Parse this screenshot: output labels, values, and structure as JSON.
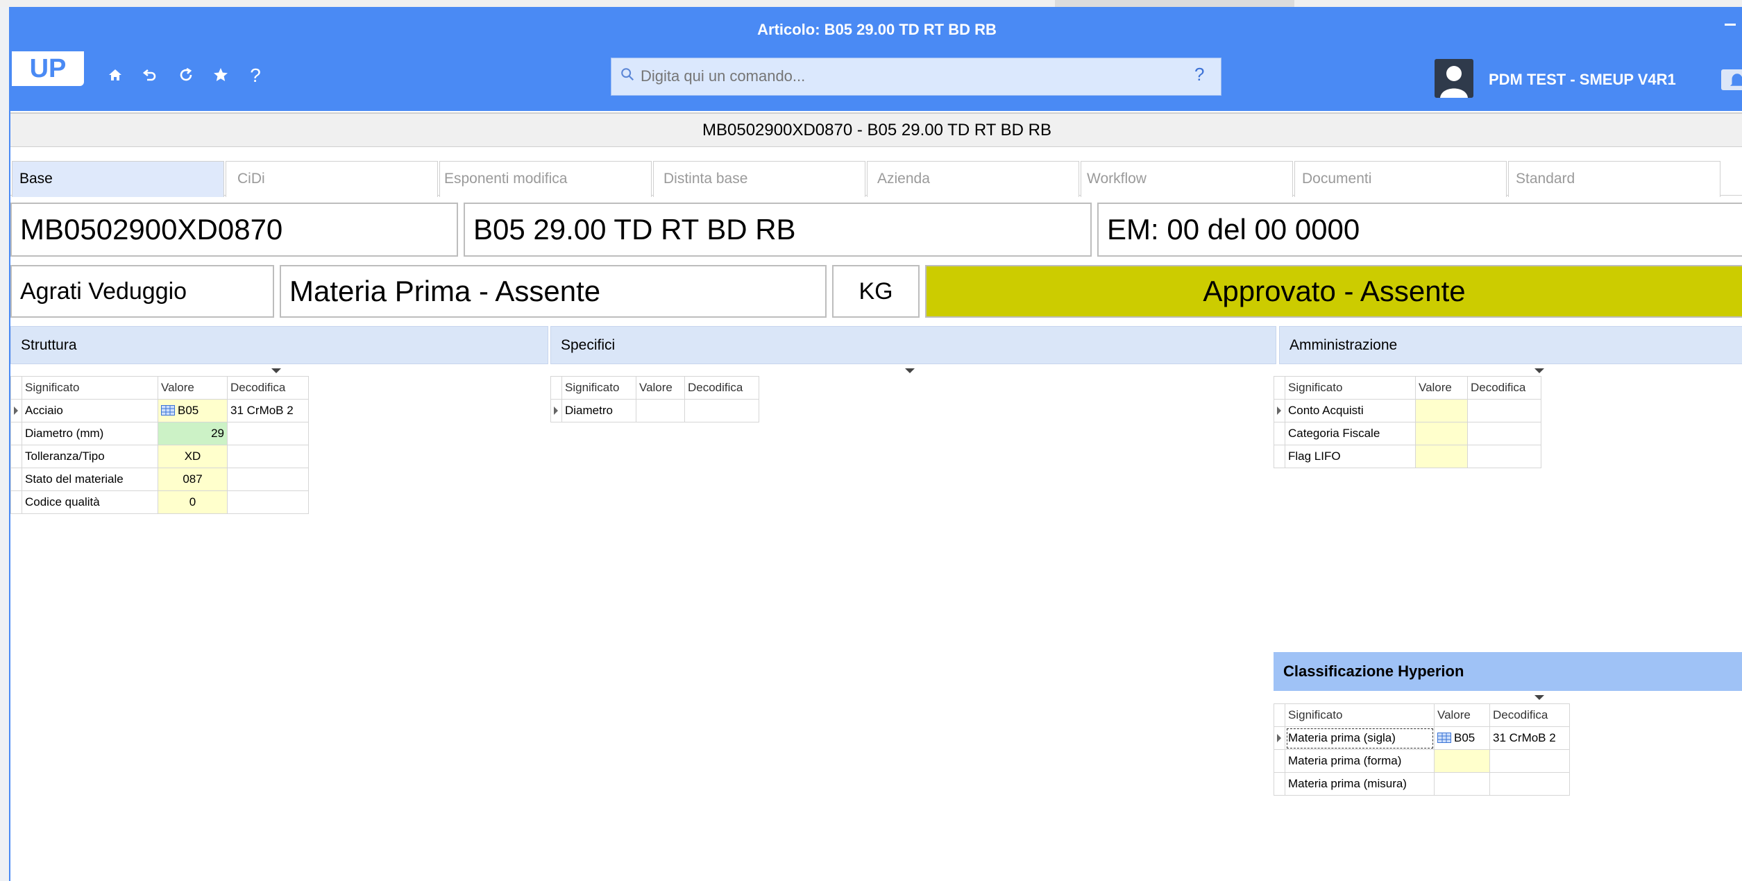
{
  "window": {
    "title": "Articolo: B05 29.00 TD RT BD RB"
  },
  "toolbar": {
    "logo": "UP",
    "home_icon": "home-icon",
    "back_icon": "undo-icon",
    "refresh_icon": "refresh-icon",
    "favorite_icon": "star-icon",
    "help_label": "?"
  },
  "search": {
    "placeholder": "Digita qui un comando...",
    "help": "?"
  },
  "user": {
    "name": "PDM TEST - SMEUP V4R1"
  },
  "item_bar": "MB0502900XD0870 - B05 29.00 TD RT BD RB",
  "tabs": [
    {
      "label": "Base"
    },
    {
      "label": "CiDi"
    },
    {
      "label": "Esponenti modifica"
    },
    {
      "label": "Distinta base"
    },
    {
      "label": "Azienda"
    },
    {
      "label": "Workflow"
    },
    {
      "label": "Documenti"
    },
    {
      "label": "Standard"
    }
  ],
  "header_fields": {
    "code": "MB0502900XD0870",
    "description": "B05 29.00 TD RT BD RB",
    "em": "EM: 00 del 00  0000",
    "plant": "Agrati Veduggio",
    "type": "Materia Prima - Assente",
    "unit": "KG",
    "status": "Approvato - Assente"
  },
  "colors": {
    "accent": "#4a8af4",
    "status": "#cccc00",
    "section": "#dae6f8",
    "value_cell": "#ffffcc",
    "value_numeric": "#ccf2c6"
  },
  "columns": {
    "significato": "Significato",
    "valore": "Valore",
    "decodifica": "Decodifica"
  },
  "struttura": {
    "title": "Struttura",
    "rows": [
      {
        "significato": "Acciaio",
        "valore": "B05",
        "decodifica": "31 CrMoB 2"
      },
      {
        "significato": "Diametro (mm)",
        "valore": "29",
        "decodifica": ""
      },
      {
        "significato": "Tolleranza/Tipo",
        "valore": "XD",
        "decodifica": ""
      },
      {
        "significato": "Stato del materiale",
        "valore": "087",
        "decodifica": ""
      },
      {
        "significato": "Codice qualità",
        "valore": "0",
        "decodifica": ""
      }
    ]
  },
  "specifici": {
    "title": "Specifici",
    "rows": [
      {
        "significato": "Diametro",
        "valore": "",
        "decodifica": ""
      }
    ]
  },
  "amministrazione": {
    "title": "Amministrazione",
    "rows": [
      {
        "significato": "Conto Acquisti",
        "valore": "",
        "decodifica": ""
      },
      {
        "significato": "Categoria Fiscale",
        "valore": "",
        "decodifica": ""
      },
      {
        "significato": "Flag LIFO",
        "valore": "",
        "decodifica": ""
      }
    ]
  },
  "hyperion": {
    "title": "Classificazione Hyperion",
    "rows": [
      {
        "significato": "Materia prima (sigla)",
        "valore": "B05",
        "decodifica": "31 CrMoB 2"
      },
      {
        "significato": "Materia prima (forma)",
        "valore": "",
        "decodifica": ""
      },
      {
        "significato": "Materia prima (misura)",
        "valore": "",
        "decodifica": ""
      }
    ]
  }
}
